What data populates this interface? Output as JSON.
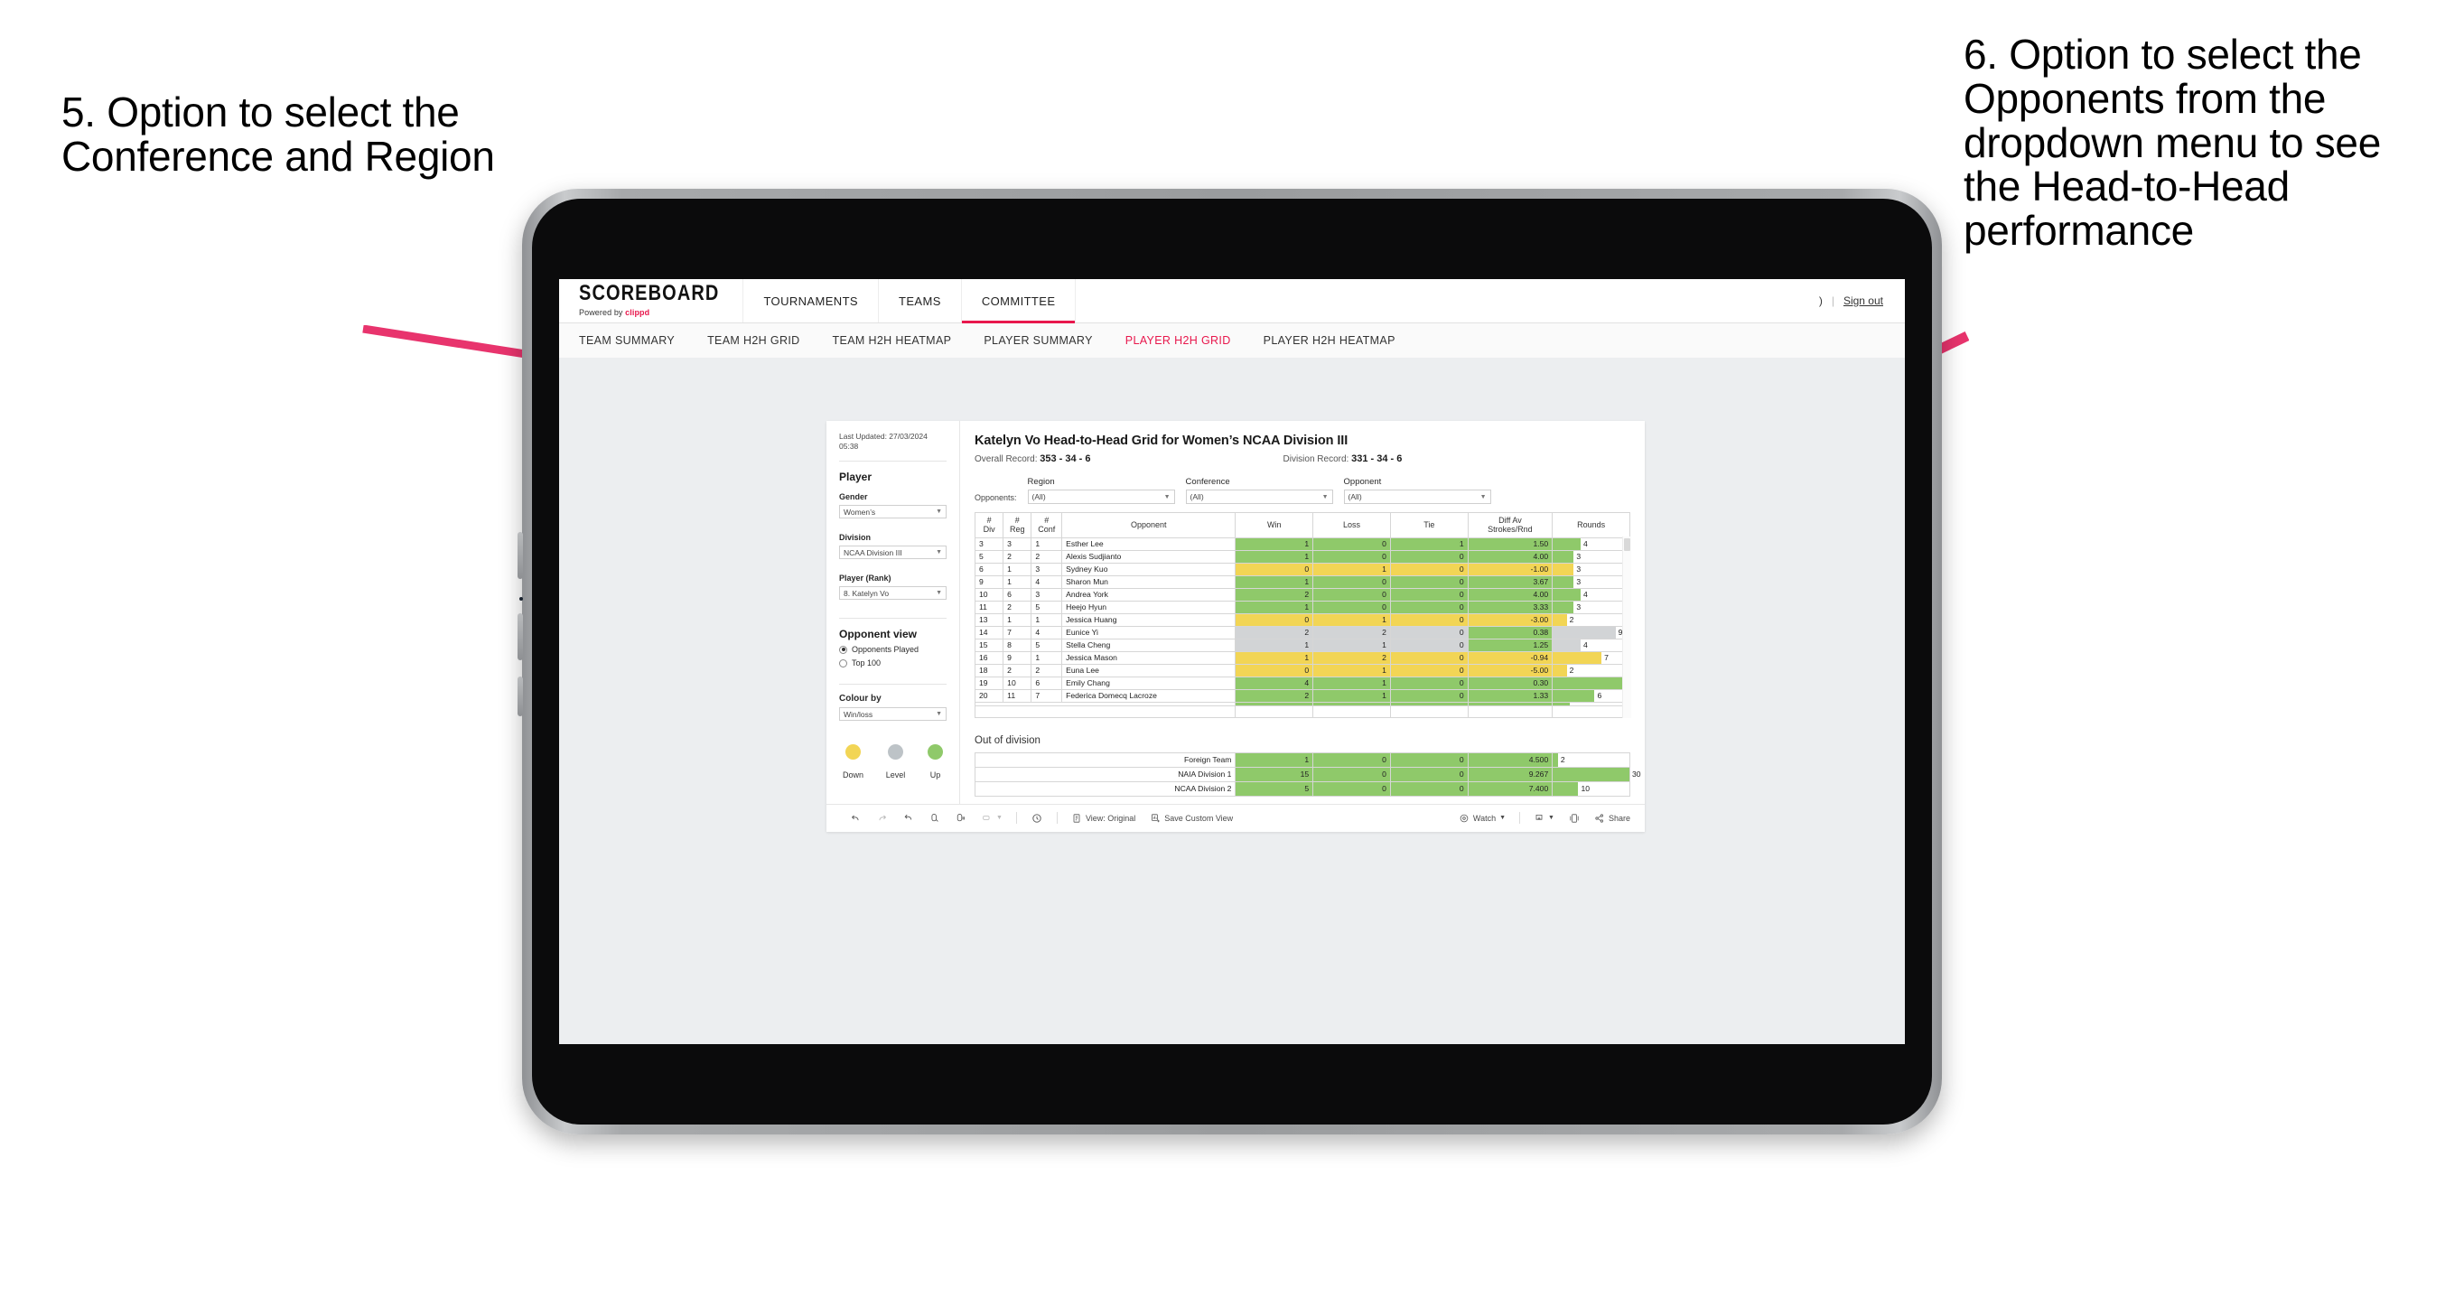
{
  "annotations": {
    "left": "5. Option to select the Conference and Region",
    "right": "6. Option to select the Opponents from the dropdown menu to see the Head-to-Head performance",
    "arrow_color": "#e8346d"
  },
  "app": {
    "brand": {
      "wordmark": "SCOREBOARD",
      "powered_prefix": "Powered by ",
      "powered_brand": "clippd"
    },
    "top_nav": [
      {
        "label": "TOURNAMENTS",
        "active": false
      },
      {
        "label": "TEAMS",
        "active": false
      },
      {
        "label": "COMMITTEE",
        "active": true
      }
    ],
    "top_right": {
      "ellipsis": ")",
      "separator": "|",
      "sign_out": "Sign out"
    },
    "sub_nav": [
      {
        "label": "TEAM SUMMARY",
        "active": false
      },
      {
        "label": "TEAM H2H GRID",
        "active": false
      },
      {
        "label": "TEAM H2H HEATMAP",
        "active": false
      },
      {
        "label": "PLAYER SUMMARY",
        "active": false
      },
      {
        "label": "PLAYER H2H GRID",
        "active": true
      },
      {
        "label": "PLAYER H2H HEATMAP",
        "active": false
      }
    ]
  },
  "sidebar": {
    "last_updated": "Last Updated: 27/03/2024 05:38",
    "player_heading": "Player",
    "gender_label": "Gender",
    "gender_value": "Women’s",
    "division_label": "Division",
    "division_value": "NCAA Division III",
    "player_rank_label": "Player (Rank)",
    "player_rank_value": "8. Katelyn Vo",
    "opponent_view_heading": "Opponent view",
    "opponent_view_options": [
      {
        "label": "Opponents Played",
        "selected": true
      },
      {
        "label": "Top 100",
        "selected": false
      }
    ],
    "colour_by_label": "Colour by",
    "colour_by_value": "Win/loss",
    "legend": [
      {
        "label": "Down",
        "color": "#f2d555"
      },
      {
        "label": "Level",
        "color": "#bdc3c7"
      },
      {
        "label": "Up",
        "color": "#8fc96a"
      }
    ]
  },
  "main": {
    "title": "Katelyn Vo Head-to-Head Grid for Women’s NCAA Division III",
    "overall_record_label": "Overall Record:",
    "overall_record_value": "353 -  34 - 6",
    "division_record_label": "Division Record:",
    "division_record_value": "331 -  34 - 6",
    "opponents_label": "Opponents:",
    "filters": [
      {
        "name": "Region",
        "value": "(All)"
      },
      {
        "name": "Conference",
        "value": "(All)"
      },
      {
        "name": "Opponent",
        "value": "(All)"
      }
    ],
    "out_of_division_title": "Out of division"
  },
  "chart_data": {
    "type": "table",
    "title": "Katelyn Vo Head-to-Head Grid for Women’s NCAA Division III",
    "columns": [
      "# Div",
      "# Reg",
      "# Conf",
      "Opponent",
      "Win",
      "Loss",
      "Tie",
      "Diff Av Strokes/Rnd",
      "Rounds"
    ],
    "column_headers_two_line": [
      [
        "#",
        "Div"
      ],
      [
        "#",
        "Reg"
      ],
      [
        "#",
        "Conf"
      ],
      [
        "Opponent",
        ""
      ],
      [
        "Win",
        ""
      ],
      [
        "Loss",
        ""
      ],
      [
        "Tie",
        ""
      ],
      [
        "Diff Av",
        "Strokes/Rnd"
      ],
      [
        "Rounds",
        ""
      ]
    ],
    "rounds_max": 11,
    "colors": {
      "up": "#8fc96a",
      "down": "#f2d555",
      "level": "#d2d4d6"
    },
    "rows": [
      {
        "div": "3",
        "reg": "3",
        "conf": "1",
        "opponent": "Esther Lee",
        "win": "1",
        "loss": "0",
        "tie": "1",
        "diff": "1.50",
        "rounds": "4",
        "state": "up"
      },
      {
        "div": "5",
        "reg": "2",
        "conf": "2",
        "opponent": "Alexis Sudjianto",
        "win": "1",
        "loss": "0",
        "tie": "0",
        "diff": "4.00",
        "rounds": "3",
        "state": "up"
      },
      {
        "div": "6",
        "reg": "1",
        "conf": "3",
        "opponent": "Sydney Kuo",
        "win": "0",
        "loss": "1",
        "tie": "0",
        "diff": "-1.00",
        "rounds": "3",
        "state": "down"
      },
      {
        "div": "9",
        "reg": "1",
        "conf": "4",
        "opponent": "Sharon Mun",
        "win": "1",
        "loss": "0",
        "tie": "0",
        "diff": "3.67",
        "rounds": "3",
        "state": "up"
      },
      {
        "div": "10",
        "reg": "6",
        "conf": "3",
        "opponent": "Andrea York",
        "win": "2",
        "loss": "0",
        "tie": "0",
        "diff": "4.00",
        "rounds": "4",
        "state": "up"
      },
      {
        "div": "11",
        "reg": "2",
        "conf": "5",
        "opponent": "Heejo Hyun",
        "win": "1",
        "loss": "0",
        "tie": "0",
        "diff": "3.33",
        "rounds": "3",
        "state": "up"
      },
      {
        "div": "13",
        "reg": "1",
        "conf": "1",
        "opponent": "Jessica Huang",
        "win": "0",
        "loss": "1",
        "tie": "0",
        "diff": "-3.00",
        "rounds": "2",
        "state": "down"
      },
      {
        "div": "14",
        "reg": "7",
        "conf": "4",
        "opponent": "Eunice Yi",
        "win": "2",
        "loss": "2",
        "tie": "0",
        "diff": "0.38",
        "rounds": "9",
        "state": "level",
        "diff_state": "up"
      },
      {
        "div": "15",
        "reg": "8",
        "conf": "5",
        "opponent": "Stella Cheng",
        "win": "1",
        "loss": "1",
        "tie": "0",
        "diff": "1.25",
        "rounds": "4",
        "state": "level",
        "diff_state": "up"
      },
      {
        "div": "16",
        "reg": "9",
        "conf": "1",
        "opponent": "Jessica Mason",
        "win": "1",
        "loss": "2",
        "tie": "0",
        "diff": "-0.94",
        "rounds": "7",
        "state": "down"
      },
      {
        "div": "18",
        "reg": "2",
        "conf": "2",
        "opponent": "Euna Lee",
        "win": "0",
        "loss": "1",
        "tie": "0",
        "diff": "-5.00",
        "rounds": "2",
        "state": "down"
      },
      {
        "div": "19",
        "reg": "10",
        "conf": "6",
        "opponent": "Emily Chang",
        "win": "4",
        "loss": "1",
        "tie": "0",
        "diff": "0.30",
        "rounds": "11",
        "state": "up"
      },
      {
        "div": "20",
        "reg": "11",
        "conf": "7",
        "opponent": "Federica Domecq Lacroze",
        "win": "2",
        "loss": "1",
        "tie": "0",
        "diff": "1.33",
        "rounds": "6",
        "state": "up"
      }
    ],
    "out_of_division": {
      "rounds_max": 30,
      "rows": [
        {
          "label": "Foreign Team",
          "win": "1",
          "loss": "0",
          "tie": "0",
          "diff": "4.500",
          "rounds": "2",
          "state": "up"
        },
        {
          "label": "NAIA Division 1",
          "win": "15",
          "loss": "0",
          "tie": "0",
          "diff": "9.267",
          "rounds": "30",
          "state": "up"
        },
        {
          "label": "NCAA Division 2",
          "win": "5",
          "loss": "0",
          "tie": "0",
          "diff": "7.400",
          "rounds": "10",
          "state": "up"
        }
      ]
    }
  },
  "bottom_toolbar": {
    "items": [
      {
        "icon": "undo-icon",
        "label": ""
      },
      {
        "icon": "redo-icon",
        "label": ""
      },
      {
        "icon": "revert-icon",
        "label": ""
      },
      {
        "icon": "refresh-data-icon",
        "label": ""
      },
      {
        "icon": "pause-refresh-icon",
        "label": ""
      },
      {
        "icon": "highlight-icon",
        "label": "",
        "caret": true
      },
      {
        "icon": "history-icon",
        "label": ""
      },
      {
        "icon": "view-original-icon",
        "label": "View: Original"
      },
      {
        "icon": "save-custom-view-icon",
        "label": "Save Custom View"
      },
      {
        "icon": "watch-icon",
        "label": "Watch",
        "caret": true
      },
      {
        "icon": "download-icon",
        "label": "",
        "caret": true
      },
      {
        "icon": "device-layout-icon",
        "label": ""
      },
      {
        "icon": "share-icon",
        "label": "Share"
      }
    ]
  }
}
